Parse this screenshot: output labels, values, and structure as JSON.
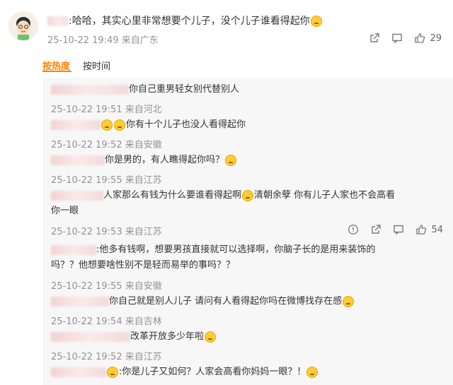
{
  "comment": {
    "text": ":哈哈，其实心里非常想要个儿子，没个儿子谁看得起你",
    "time": "25-10-22 19:49",
    "location": "来自广东",
    "likes": "29"
  },
  "tabs": {
    "hot": "按热度",
    "time": "按时间"
  },
  "replies": [
    {
      "text": "你自己重男轻女别代替别人",
      "time": "25-10-22 19:51",
      "location": "来自河北"
    },
    {
      "text": "你有十个儿子也没人看得起你",
      "time": "25-10-22 19:52",
      "location": "来自安徽"
    },
    {
      "text": "你是男的，有人瞧得起你吗？",
      "time": "25-10-22 19:55",
      "location": "来自江苏"
    },
    {
      "text": "人家那么有钱为什么要谁看得起啊",
      "text2": "清朝余孽 你有儿子人家也不会高看",
      "text3": "你一眼",
      "time": "25-10-22 19:53",
      "location": "来自江苏",
      "likes": "54"
    },
    {
      "text": ":他多有钱啊，想要男孩直接就可以选择啊，你脑子长的是用来装饰的",
      "text2": "吗？？他想要啥性别不是轻而易举的事吗？？",
      "time": "25-10-22 19:55",
      "location": "来自安徽"
    },
    {
      "text": "你自己就是别人儿子 请问有人看得起你吗在微博找存在感",
      "time": "25-10-22 19:54",
      "location": "来自吉林"
    },
    {
      "text": "改革开放多少年啦",
      "time": "25-10-22 19:52",
      "location": "来自江苏"
    },
    {
      "text": ":你是儿子又如何？人家会高看你妈妈一眼？！"
    }
  ]
}
